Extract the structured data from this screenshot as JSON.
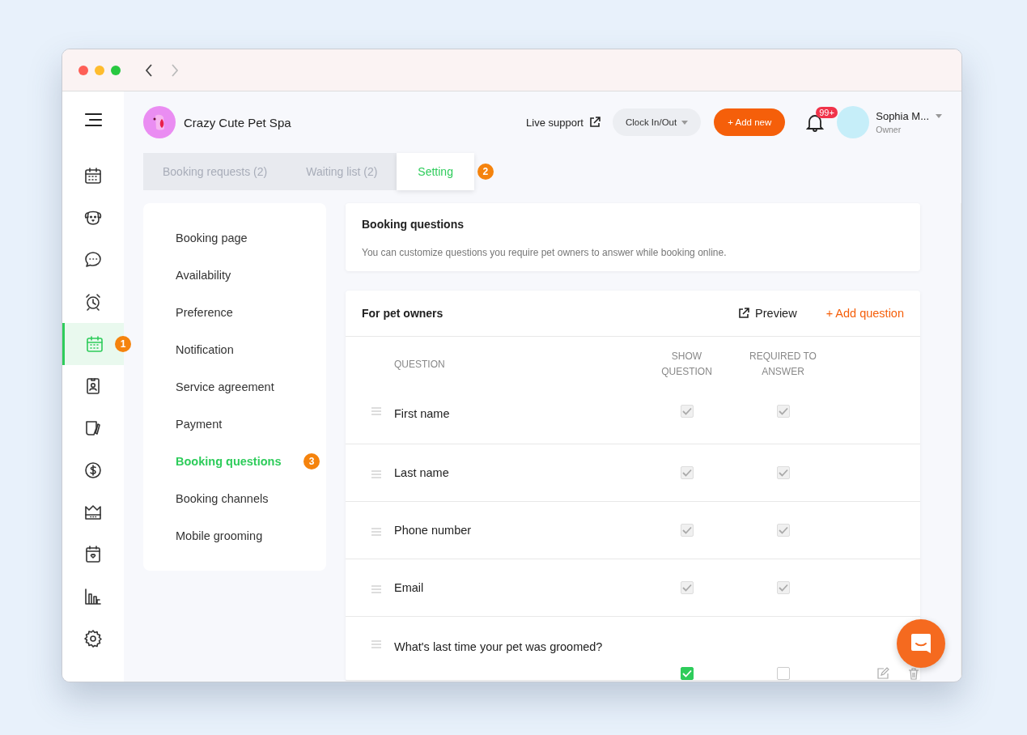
{
  "window": {
    "nav": {
      "back_enabled": true,
      "forward_enabled": false
    }
  },
  "sidebar": {
    "items": [
      {
        "selected": false
      },
      {
        "selected": false
      },
      {
        "selected": false
      },
      {
        "selected": false
      },
      {
        "selected": true,
        "step": "1"
      },
      {
        "selected": false
      },
      {
        "selected": false
      },
      {
        "selected": false
      },
      {
        "selected": false
      },
      {
        "selected": false
      },
      {
        "selected": false
      },
      {
        "selected": false
      }
    ]
  },
  "header": {
    "business_name": "Crazy Cute Pet Spa",
    "live_support": "Live support",
    "clock_button": "Clock In/Out",
    "add_button": "+ Add new",
    "notification_count": "99+",
    "user_name": "Sophia M...",
    "user_role": "Owner"
  },
  "tabs": [
    {
      "label": "Booking requests (2)",
      "selected": false
    },
    {
      "label": "Waiting list (2)",
      "selected": false
    },
    {
      "label": "Setting",
      "selected": true,
      "step": "2"
    }
  ],
  "settings_menu": [
    {
      "label": "Booking page",
      "selected": false
    },
    {
      "label": "Availability",
      "selected": false
    },
    {
      "label": "Preference",
      "selected": false
    },
    {
      "label": "Notification",
      "selected": false
    },
    {
      "label": "Service agreement",
      "selected": false
    },
    {
      "label": "Payment",
      "selected": false
    },
    {
      "label": "Booking questions",
      "selected": true,
      "step": "3"
    },
    {
      "label": "Booking channels",
      "selected": false
    },
    {
      "label": "Mobile grooming",
      "selected": false
    }
  ],
  "intro": {
    "title": "Booking questions",
    "description": "You can customize questions you require pet owners to answer while booking online."
  },
  "questions_card": {
    "title": "For pet owners",
    "preview": "Preview",
    "add_question": "+ Add question",
    "columns": [
      "QUESTION",
      "SHOW QUESTION",
      "REQUIRED TO ANSWER"
    ],
    "rows": [
      {
        "kind": "default",
        "question": "First name",
        "show": true,
        "required": true,
        "disabled": true
      },
      {
        "kind": "default",
        "question": "Last name",
        "show": true,
        "required": true,
        "disabled": true
      },
      {
        "kind": "default",
        "question": "Phone number",
        "show": true,
        "required": true,
        "disabled": true
      },
      {
        "kind": "default",
        "question": "Email",
        "show": true,
        "required": true,
        "disabled": true
      },
      {
        "kind": "custom",
        "question": "What's last time your pet was groomed?",
        "show": true,
        "required": false,
        "disabled": false
      }
    ]
  }
}
